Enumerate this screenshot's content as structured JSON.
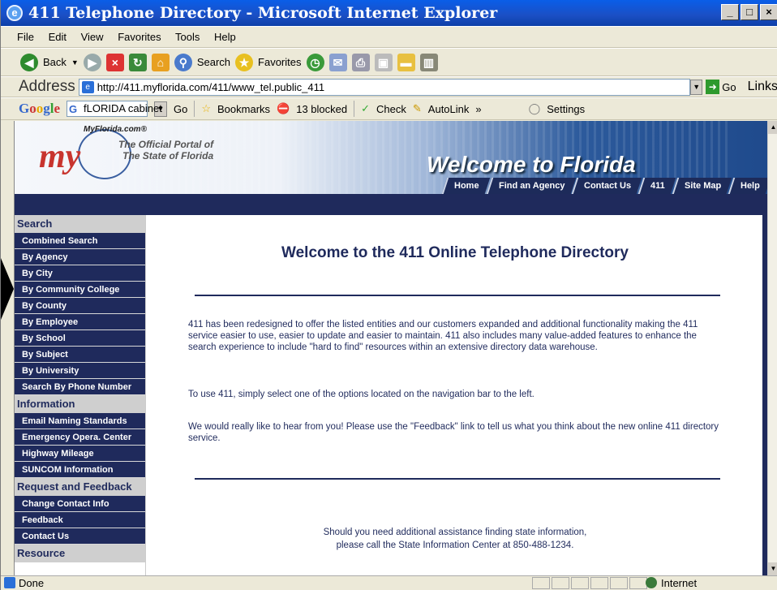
{
  "window": {
    "title": "411 Telephone Directory - Microsoft Internet Explorer",
    "controls": [
      "_",
      "□",
      "×"
    ]
  },
  "menu": [
    "File",
    "Edit",
    "View",
    "Favorites",
    "Tools",
    "Help"
  ],
  "toolbar": {
    "back": "Back",
    "search": "Search",
    "favorites": "Favorites"
  },
  "address": {
    "label": "Address",
    "url": "http://411.myflorida.com/411/www_tel.public_411",
    "go": "Go",
    "links": "Links"
  },
  "google": {
    "logo": "Google",
    "query": "fLORIDA cabinet",
    "go": "Go",
    "bookmarks": "Bookmarks",
    "blocked": "13 blocked",
    "check": "Check",
    "autolink": "AutoLink",
    "more": "»",
    "settings": "Settings"
  },
  "banner": {
    "myflorida": "MyFlorida.com®",
    "logo": "my",
    "portal_line1": "The Official Portal of",
    "portal_line2": "The State of Florida",
    "welcome": "Welcome to Florida",
    "nav": [
      "Home",
      "Find an Agency",
      "Contact Us",
      "411",
      "Site Map",
      "Help"
    ]
  },
  "sidebar": {
    "search_header": "Search",
    "search_items": [
      "Combined Search",
      "By Agency",
      "By City",
      "By Community College",
      "By County",
      "By Employee",
      "By School",
      "By Subject",
      "By University",
      "Search By Phone Number"
    ],
    "information_header": "Information",
    "information_items": [
      "Email Naming Standards",
      "Emergency Opera. Center",
      "Highway Mileage",
      "SUNCOM Information"
    ],
    "request_header": "Request and Feedback",
    "request_items": [
      "Change Contact Info",
      "Feedback",
      "Contact Us"
    ],
    "resource_header": "Resource"
  },
  "main": {
    "heading": "Welcome to the 411 Online Telephone Directory",
    "p1": "411 has been redesigned to offer the listed entities and our customers expanded and additional functionality making the 411 service easier to use, easier to update and easier to maintain. 411 also includes many value-added features to enhance the search experience to include \"hard to find\" resources within an extensive directory data warehouse.",
    "p2": "To use 411, simply select one of the options located on the navigation bar to the left.",
    "p3": "We would really like to hear from you! Please use the \"Feedback\" link to tell us what you think about the new online 411 directory service.",
    "footer1": "Should you need additional assistance finding state information,",
    "footer2": "please call the State Information Center at 850-488-1234."
  },
  "status": {
    "text": "Done",
    "zone": "Internet"
  }
}
